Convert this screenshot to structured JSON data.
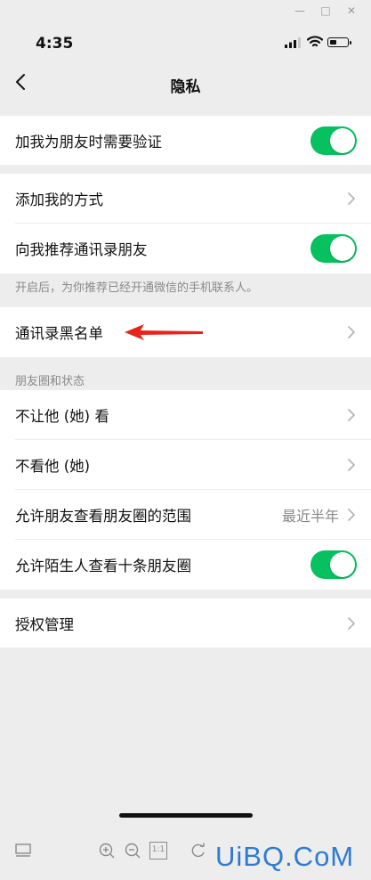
{
  "status_bar": {
    "time": "4:35",
    "battery_level": 0.4
  },
  "nav": {
    "title": "隐私"
  },
  "settings": {
    "verify_label": "加我为朋友时需要验证",
    "verify_enabled": true,
    "add_methods_label": "添加我的方式",
    "recommend_contacts_label": "向我推荐通讯录朋友",
    "recommend_contacts_enabled": true,
    "recommend_hint": "开启后，为你推荐已经开通微信的手机联系人。",
    "blacklist_label": "通讯录黑名单",
    "moments_section_title": "朋友圈和状态",
    "dont_let_see_label": "不让他 (她) 看",
    "dont_see_label": "不看他 (她)",
    "moments_range_label": "允许朋友查看朋友圈的范围",
    "moments_range_value": "最近半年",
    "stranger_ten_label": "允许陌生人查看十条朋友圈",
    "stranger_ten_enabled": true,
    "authorization_label": "授权管理"
  },
  "toolbar": {
    "zoom_ratio_label": "1:1"
  },
  "watermark": {
    "text": "UiBQ.CoM"
  },
  "colors": {
    "toggle_on": "#07c160",
    "background": "#ededed",
    "arrow": "#e8231e",
    "watermark": "#2c7cd6"
  }
}
